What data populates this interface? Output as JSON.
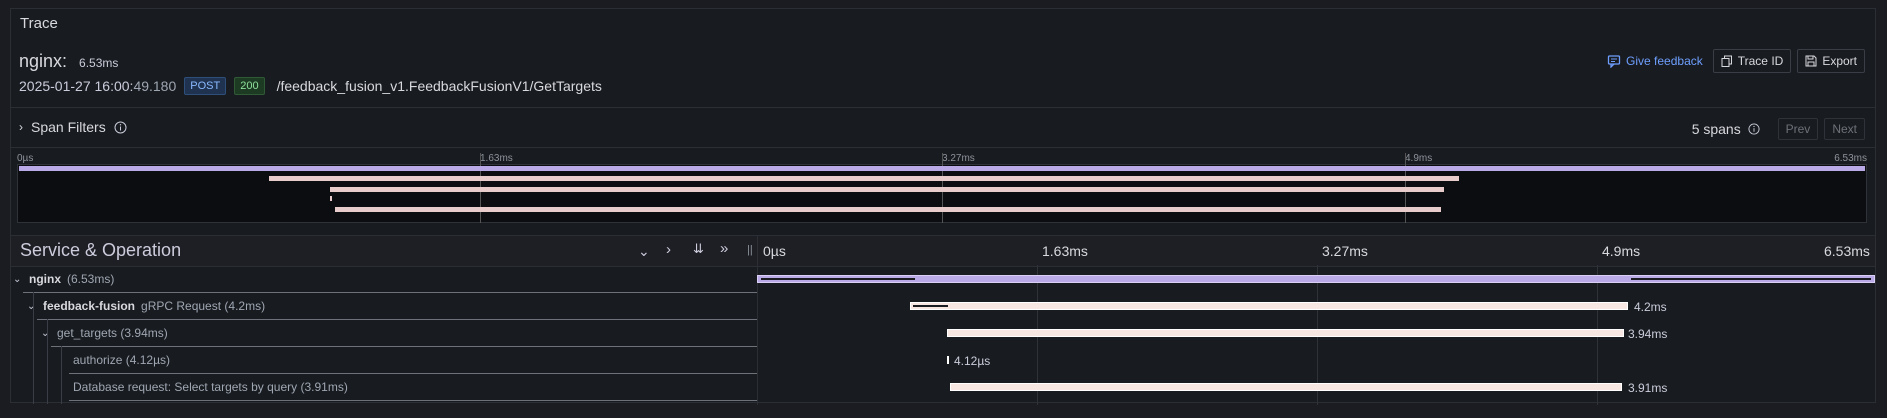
{
  "panel": {
    "title": "Trace"
  },
  "trace": {
    "service": "nginx:",
    "duration": "6.53ms",
    "timestamp_main": "2025-01-27 16:00:",
    "timestamp_ms": "49.180",
    "method": "POST",
    "status": "200",
    "path": "/feedback_fusion_v1.FeedbackFusionV1/GetTargets"
  },
  "actions": {
    "feedback": "Give feedback",
    "trace_id": "Trace ID",
    "export": "Export"
  },
  "filters": {
    "label": "Span Filters",
    "span_count": "5 spans",
    "prev": "Prev",
    "next": "Next"
  },
  "minimap": {
    "ticks": [
      "0µs",
      "1.63ms",
      "3.27ms",
      "4.9ms",
      "6.53ms"
    ]
  },
  "timeline": {
    "title": "Service & Operation",
    "ticks": [
      "0µs",
      "1.63ms",
      "3.27ms",
      "4.9ms",
      "6.53ms"
    ],
    "rows": [
      {
        "service": "nginx",
        "operation": "",
        "duration": "(6.53ms)",
        "bar_label": ""
      },
      {
        "service": "feedback-fusion",
        "operation": "gRPC Request",
        "duration": "(4.2ms)",
        "bar_label": "4.2ms"
      },
      {
        "service": "",
        "operation": "get_targets",
        "duration": "(3.94ms)",
        "bar_label": "3.94ms"
      },
      {
        "service": "",
        "operation": "authorize",
        "duration": "(4.12µs)",
        "bar_label": "4.12µs"
      },
      {
        "service": "",
        "operation": "Database request: Select targets by query",
        "duration": "(3.91ms)",
        "bar_label": "3.91ms"
      }
    ]
  },
  "colors": {
    "root_span": "#b9a9e6",
    "child_span": "#f7e6e2",
    "accent_link": "#6e9fff"
  },
  "icons": [
    "chevron-right-icon",
    "info-icon",
    "comment-icon",
    "copy-icon",
    "save-icon",
    "chevron-down-icon",
    "chevron-double-down-icon",
    "chevron-double-right-icon"
  ]
}
